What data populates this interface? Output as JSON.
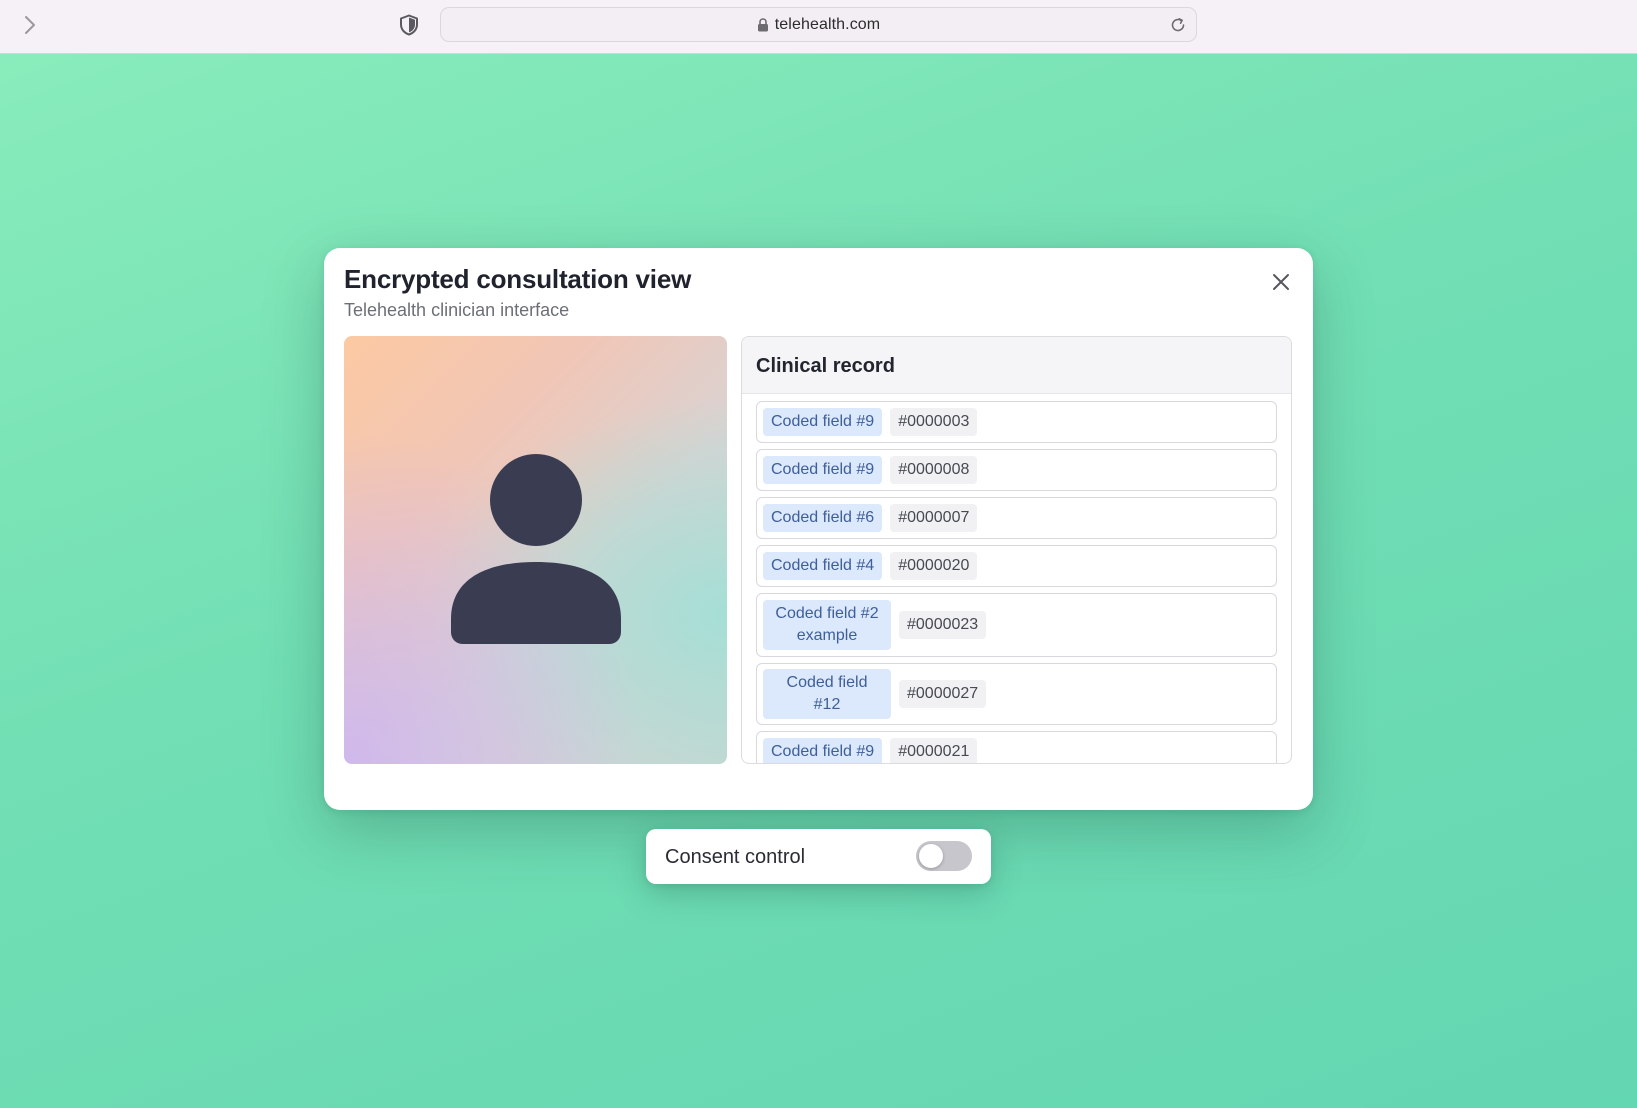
{
  "browser": {
    "url": "telehealth.com"
  },
  "modal": {
    "title": "Encrypted consultation view",
    "subtitle": "Telehealth clinician interface"
  },
  "record": {
    "title": "Clinical record",
    "rows": [
      {
        "field": "Coded field #9",
        "value": "#0000003"
      },
      {
        "field": "Coded field #9",
        "value": "#0000008"
      },
      {
        "field": "Coded field #6",
        "value": "#0000007"
      },
      {
        "field": "Coded field #4",
        "value": "#0000020"
      },
      {
        "field": "Coded field #2 example",
        "value": "#0000023"
      },
      {
        "field": "Coded field #12",
        "value": "#0000027"
      },
      {
        "field": "Coded field #9",
        "value": "#0000021"
      }
    ]
  },
  "consent": {
    "label": "Consent control",
    "enabled": false
  },
  "colors": {
    "background": "#72dfb4",
    "tag_bg": "#dce8fb",
    "tag_text": "#3d5f9a",
    "avatar": "#3a3d52",
    "toggle_off": "#c6c6cc"
  },
  "icons": {
    "forward": "chevron-right-icon",
    "shield": "shield-icon",
    "lock": "lock-icon",
    "reload": "reload-icon",
    "close": "close-icon",
    "avatar": "person-icon"
  }
}
